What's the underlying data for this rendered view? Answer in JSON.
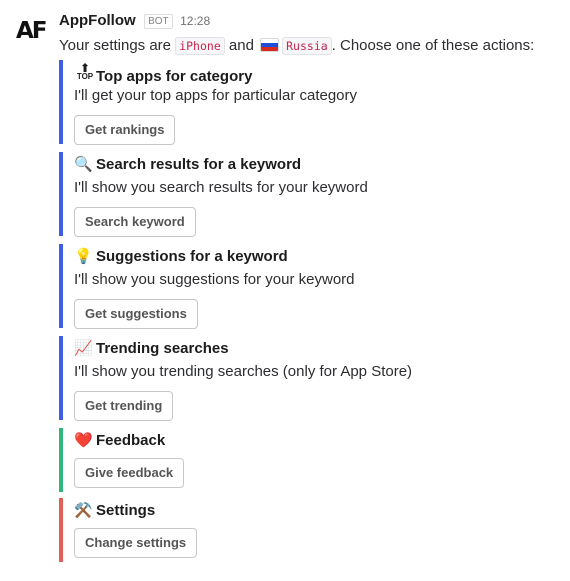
{
  "message": {
    "logo_text": "AF",
    "sender": "AppFollow",
    "bot_badge": "BOT",
    "time": "12:28",
    "intro_prefix": "Your settings are",
    "device": "iPhone",
    "intro_and": "and",
    "country": "Russia",
    "intro_suffix": ". Choose one of these actions:"
  },
  "colors": {
    "accent_blue": "#3c5ee8",
    "accent_green": "#2eb67d",
    "accent_red": "#e06055"
  },
  "attachments": [
    {
      "emoji": "🔝",
      "emoji_name": "top-icon",
      "title": "Top apps for category",
      "text": "I'll get your top apps for particular category",
      "button": "Get rankings",
      "color": "#3c5ee8"
    },
    {
      "emoji": "🔍",
      "emoji_name": "magnifier-icon",
      "title": "Search results for a keyword",
      "text": "I'll show you search results for your keyword",
      "button": "Search keyword",
      "color": "#3c5ee8"
    },
    {
      "emoji": "💡",
      "emoji_name": "bulb-icon",
      "title": "Suggestions for a keyword",
      "text": "I'll show you suggestions for your keyword",
      "button": "Get suggestions",
      "color": "#3c5ee8"
    },
    {
      "emoji": "📈",
      "emoji_name": "chart-icon",
      "title": "Trending searches",
      "text": "I'll show you trending searches (only for App Store)",
      "button": "Get trending",
      "color": "#3c5ee8"
    },
    {
      "emoji": "❤️",
      "emoji_name": "heart-icon",
      "title": "Feedback",
      "text": "",
      "button": "Give feedback",
      "color": "#2eb67d"
    },
    {
      "emoji": "⚒️",
      "emoji_name": "hammer-pick-icon",
      "title": "Settings",
      "text": "",
      "button": "Change settings",
      "color": "#e06055"
    }
  ]
}
